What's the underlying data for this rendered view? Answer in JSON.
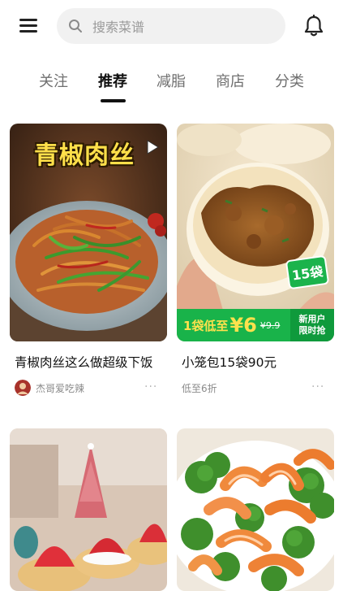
{
  "header": {
    "search_placeholder": "搜索菜谱",
    "icons": {
      "menu": "menu-icon",
      "search": "search-icon",
      "notifications": "bell-icon"
    }
  },
  "tabs": [
    {
      "label": "关注",
      "active": false
    },
    {
      "label": "推荐",
      "active": true
    },
    {
      "label": "减脂",
      "active": false
    },
    {
      "label": "商店",
      "active": false
    },
    {
      "label": "分类",
      "active": false
    }
  ],
  "feed": [
    {
      "image_overlay_title": "青椒肉丝",
      "title": "青椒肉丝这么做超级下饭",
      "author": "杰哥爱吃辣",
      "more": "···"
    },
    {
      "badge": "15袋",
      "promo": {
        "text": "1袋低至",
        "price": "¥6",
        "original_price": "¥9.9",
        "tag_line1": "新用户",
        "tag_line2": "限时抢"
      },
      "title": "小笼包15袋90元",
      "subtitle": "低至6折",
      "more": "···"
    },
    {
      "title": "",
      "image": "cupcakes-photo"
    },
    {
      "title": "",
      "image": "shrimp-broccoli-photo"
    }
  ],
  "colors": {
    "accent_green": "#19b34a",
    "promo_yellow": "#ffe14d",
    "overlay_yellow": "#ffe04a",
    "search_bg": "#f1f1f1",
    "active_tab": "#111111",
    "inactive_tab": "#6f6f6f"
  }
}
